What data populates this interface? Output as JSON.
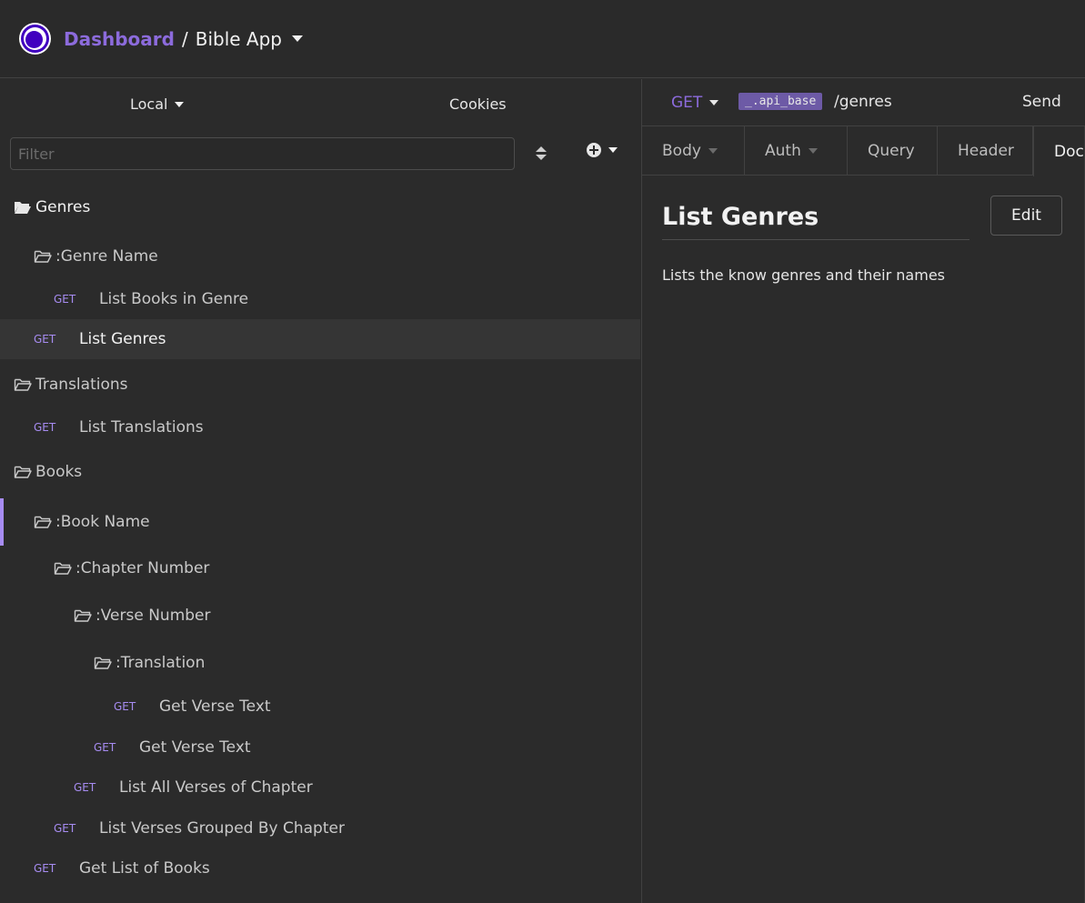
{
  "breadcrumb": {
    "dashboard": "Dashboard",
    "separator": "/",
    "workspace": "Bible App"
  },
  "sidebar": {
    "environment": "Local",
    "cookies": "Cookies",
    "filter_placeholder": "Filter",
    "tree": [
      {
        "kind": "folder",
        "label": "Genres",
        "level": 0,
        "open": true
      },
      {
        "kind": "folder",
        "label": ":Genre Name",
        "level": 1,
        "open": false
      },
      {
        "kind": "request",
        "method": "GET",
        "label": "List Books in Genre",
        "level": 2
      },
      {
        "kind": "request",
        "method": "GET",
        "label": "List Genres",
        "level": 1,
        "active": true
      },
      {
        "kind": "folder",
        "label": "Translations",
        "level": 0,
        "open": false
      },
      {
        "kind": "request",
        "method": "GET",
        "label": "List Translations",
        "level": 1
      },
      {
        "kind": "folder",
        "label": "Books",
        "level": 0,
        "open": false
      },
      {
        "kind": "folder",
        "label": ":Book Name",
        "level": 1,
        "open": false,
        "marked": true
      },
      {
        "kind": "folder",
        "label": ":Chapter Number",
        "level": 2,
        "open": false
      },
      {
        "kind": "folder",
        "label": ":Verse Number",
        "level": 3,
        "open": false
      },
      {
        "kind": "folder",
        "label": ":Translation",
        "level": 4,
        "open": false
      },
      {
        "kind": "request",
        "method": "GET",
        "label": "Get Verse Text",
        "level": 5
      },
      {
        "kind": "request",
        "method": "GET",
        "label": "Get Verse Text",
        "level": 4
      },
      {
        "kind": "request",
        "method": "GET",
        "label": "List All Verses of Chapter",
        "level": 3
      },
      {
        "kind": "request",
        "method": "GET",
        "label": "List Verses Grouped By Chapter",
        "level": 2
      },
      {
        "kind": "request",
        "method": "GET",
        "label": "Get List of Books",
        "level": 1
      }
    ]
  },
  "request": {
    "method": "GET",
    "base_var": "_.api_base",
    "path": "/genres",
    "send_label": "Send",
    "tabs": [
      {
        "label": "Body",
        "dropdown": true
      },
      {
        "label": "Auth",
        "dropdown": true
      },
      {
        "label": "Query",
        "dropdown": false
      },
      {
        "label": "Header",
        "dropdown": false
      },
      {
        "label": "Doc",
        "dropdown": false,
        "active": true
      }
    ]
  },
  "docs": {
    "title": "List Genres",
    "edit_label": "Edit",
    "description": "Lists the know genres and their names"
  },
  "colors": {
    "accent": "#8c6bdc",
    "method_get": "#a78cf2",
    "background": "#2b2b2b"
  }
}
